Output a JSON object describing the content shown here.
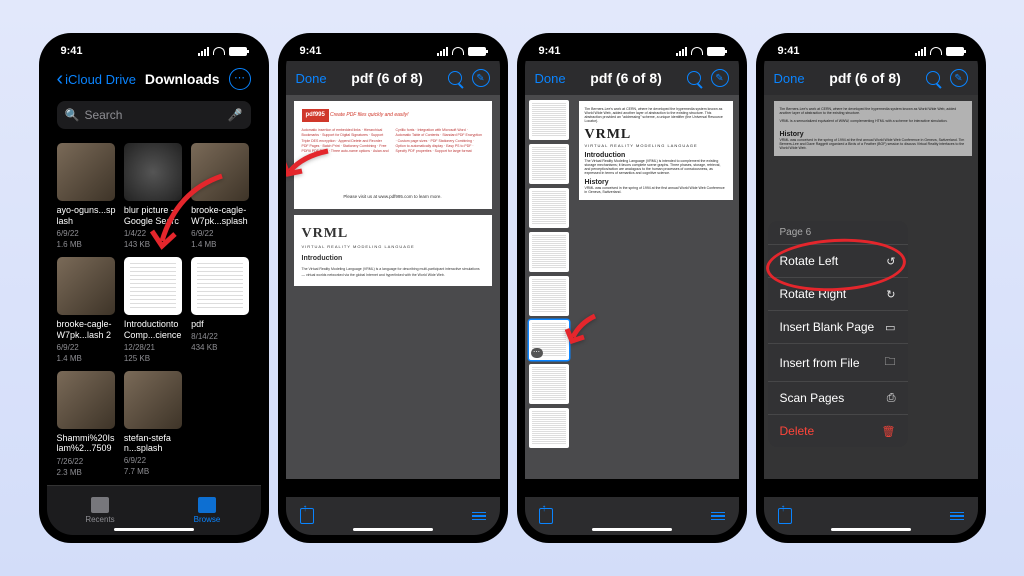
{
  "status": {
    "time": "9:41"
  },
  "files_screen": {
    "back_label": "iCloud Drive",
    "title": "Downloads",
    "search_placeholder": "Search",
    "files": [
      {
        "name": "ayo-oguns...splash",
        "date": "6/9/22",
        "size": "1.6 MB",
        "thumb": "img"
      },
      {
        "name": "blur picture - Google Search",
        "date": "1/4/22",
        "size": "143 KB",
        "thumb": "blur"
      },
      {
        "name": "brooke-cagle-W7pk...splash",
        "date": "6/9/22",
        "size": "1.4 MB",
        "thumb": "img"
      },
      {
        "name": "brooke-cagle-W7pk...lash 2",
        "date": "6/9/22",
        "size": "1.4 MB",
        "thumb": "img"
      },
      {
        "name": "Introductionto Comp...cience",
        "date": "12/28/21",
        "size": "125 KB",
        "thumb": "doc"
      },
      {
        "name": "pdf",
        "date": "8/14/22",
        "size": "434 KB",
        "thumb": "doc"
      },
      {
        "name": "Shammi%20Islam%2...75099",
        "date": "7/26/22",
        "size": "2.3 MB",
        "thumb": "img"
      },
      {
        "name": "stefan-stefan...splash",
        "date": "6/9/22",
        "size": "7.7 MB",
        "thumb": "img"
      }
    ],
    "tabs": {
      "recents": "Recents",
      "browse": "Browse"
    }
  },
  "pdf_screen": {
    "done": "Done",
    "title": "pdf (6 of 8)",
    "pdf995_logo": "pdf995",
    "pdf995_tagline": "Create PDF files quickly and easily!",
    "visit_text": "Please visit us at www.pdf995.com to learn more.",
    "vrml_title": "VRML",
    "vrml_sub": "VIRTUAL REALITY MODELING LANGUAGE",
    "intro_heading": "Introduction",
    "history_heading": "History"
  },
  "context_menu": {
    "page_label": "Page 6",
    "items": [
      {
        "label": "Rotate Left",
        "icon": "↺",
        "danger": false
      },
      {
        "label": "Rotate Right",
        "icon": "↻",
        "danger": false
      },
      {
        "label": "Insert Blank Page",
        "icon": "▭",
        "danger": false
      },
      {
        "label": "Insert from File",
        "icon": "🗀",
        "danger": false
      },
      {
        "label": "Scan Pages",
        "icon": "⎙",
        "danger": false
      },
      {
        "label": "Delete",
        "icon": "🗑",
        "danger": true
      }
    ]
  }
}
